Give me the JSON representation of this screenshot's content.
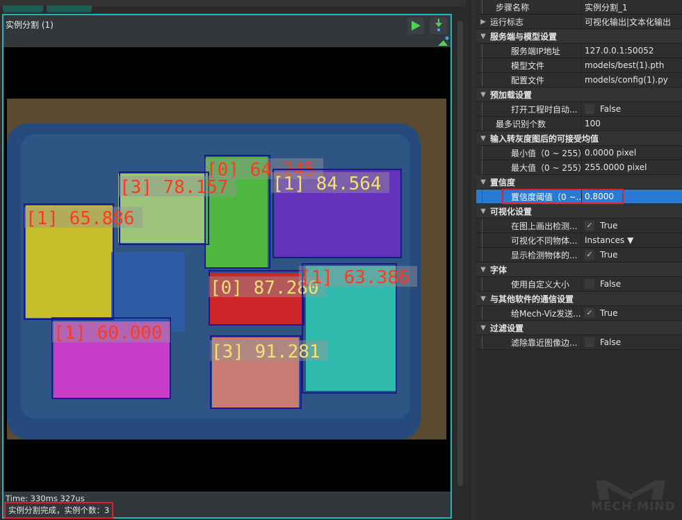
{
  "viewer": {
    "title": "实例分割 (1)",
    "time": "Time: 330ms 327us",
    "status": "实例分割完成，实例个数：3"
  },
  "detections": [
    {
      "label": "[0] 64.245",
      "color": "#ff3a1a"
    },
    {
      "label": "[3] 78.157",
      "color": "#ff3a1a"
    },
    {
      "label": "[1] 84.564",
      "color": "#f5e070"
    },
    {
      "label": "[1] 65.886",
      "color": "#ff3a1a"
    },
    {
      "label": "[0] 87.280",
      "color": "#f5e070"
    },
    {
      "label": "[1] 63.386",
      "color": "#ff3a1a"
    },
    {
      "label": "[1] 60.000",
      "color": "#ff3a1a"
    },
    {
      "label": "[3] 91.281",
      "color": "#f5e070"
    }
  ],
  "props": [
    {
      "type": "item",
      "k": "步骤名称",
      "v": "实例分割_1",
      "level": 0
    },
    {
      "type": "collapsed",
      "k": "运行标志",
      "v": "可视化输出|文本化输出"
    },
    {
      "type": "group",
      "k": "服务端与模型设置"
    },
    {
      "type": "item",
      "k": "服务端IP地址",
      "v": "127.0.0.1:50052",
      "level": 1
    },
    {
      "type": "item",
      "k": "模型文件",
      "v": "models/best(1).pth",
      "level": 1
    },
    {
      "type": "item",
      "k": "配置文件",
      "v": "models/config(1).py",
      "level": 1
    },
    {
      "type": "group",
      "k": "预加载设置"
    },
    {
      "type": "check",
      "k": "打开工程时自动...",
      "v": "False",
      "checked": false,
      "level": 1
    },
    {
      "type": "item",
      "k": "最多识别个数",
      "v": "100",
      "level": 0
    },
    {
      "type": "group",
      "k": "输入转灰度图后的可接受均值"
    },
    {
      "type": "item",
      "k": "最小值（0 ~ 255）",
      "v": "0.0000 pixel",
      "level": 1
    },
    {
      "type": "item",
      "k": "最大值（0 ~ 255）",
      "v": "255.0000 pixel",
      "level": 1
    },
    {
      "type": "group",
      "k": "置信度"
    },
    {
      "type": "selected",
      "k": "置信度阈值（0 ~...",
      "v": "0.8000",
      "level": 1
    },
    {
      "type": "group",
      "k": "可视化设置"
    },
    {
      "type": "check",
      "k": "在图上画出检测...",
      "v": "True",
      "checked": true,
      "level": 1
    },
    {
      "type": "item",
      "k": "可视化不同物体...",
      "v": "Instances ▼",
      "level": 1
    },
    {
      "type": "check",
      "k": "显示检测物体的...",
      "v": "True",
      "checked": true,
      "level": 1
    },
    {
      "type": "group",
      "k": "字体"
    },
    {
      "type": "check",
      "k": "使用自定义大小",
      "v": "False",
      "checked": false,
      "level": 1
    },
    {
      "type": "group",
      "k": "与其他软件的通信设置"
    },
    {
      "type": "check",
      "k": "给Mech-Viz发送...",
      "v": "True",
      "checked": true,
      "level": 1
    },
    {
      "type": "group",
      "k": "过滤设置"
    },
    {
      "type": "check",
      "k": "滤除靠近图像边...",
      "v": "False",
      "checked": false,
      "level": 1
    }
  ],
  "logo": "MECH MIND"
}
